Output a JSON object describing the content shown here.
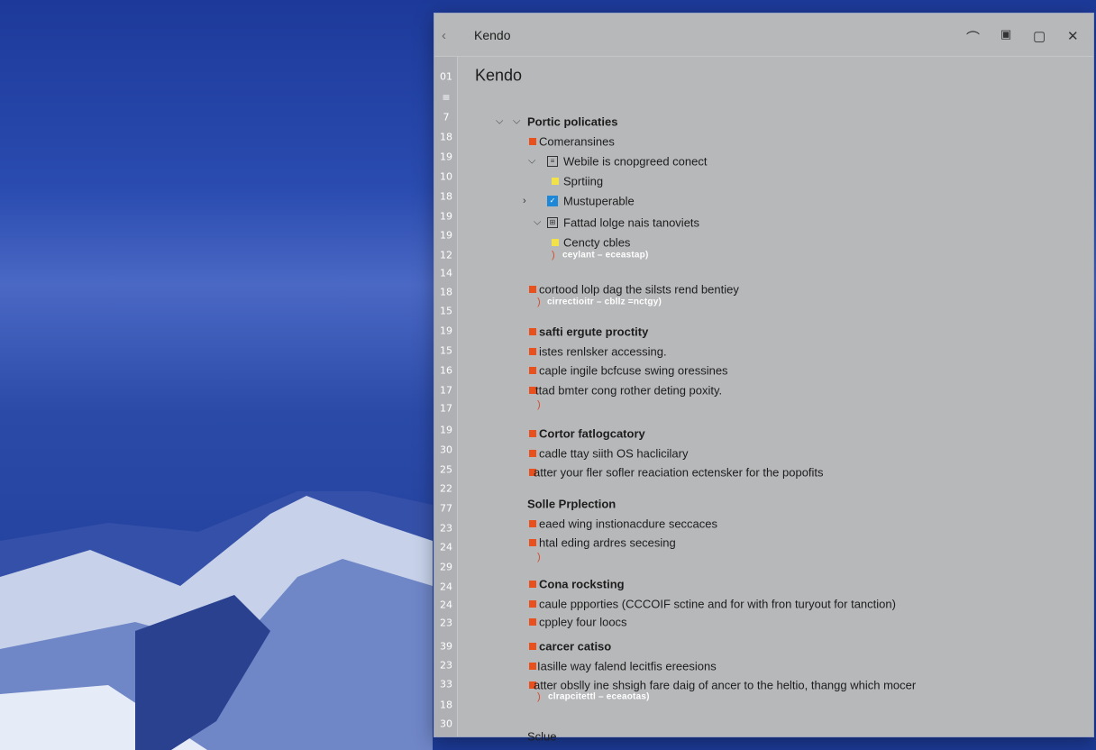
{
  "window": {
    "title": "Kendo",
    "heading": "Kendo"
  },
  "line_numbers": [
    "01",
    "≡",
    "7",
    "18",
    "19",
    "10",
    "18",
    "19",
    "19",
    "12",
    "14",
    "18",
    "15",
    "19",
    "15",
    "16",
    "17",
    "17",
    "19",
    "30",
    "25",
    "22",
    "77",
    "23",
    "24",
    "29",
    "24",
    "24",
    "23",
    "39",
    "23",
    "33",
    "18",
    "30"
  ],
  "tree": {
    "root": "Portic policaties",
    "item1": "Comeransines",
    "item2": "Webile is cnopgreed conect",
    "item3": "Sprtiing",
    "item4": "Mustuperable",
    "item5": "Fattad lolge nais tanoviets",
    "item6": "Cencty cbles",
    "comment1": "ceylant – eceastap)",
    "item7": "cortood lolp dag the silsts rend bentiey",
    "comment2": "cirrectioitr – cbllz =nctgy)"
  },
  "sections": [
    {
      "title": "safti ergute proctity",
      "items": [
        "istes renlsker accessing.",
        "caple ingile bcfcuse swing oressines",
        "ttad bmter cong rother deting poxity."
      ]
    },
    {
      "title": "Cortor fatlogcatory",
      "items": [
        "cadle ttay siith OS haclicilary",
        "atter your fler sofler reaciation ectensker for the popofits"
      ]
    },
    {
      "title": "Solle Prplection",
      "items": [
        "eaed wing instionacdure seccaces",
        "htal eding ardres secesing"
      ]
    },
    {
      "title": "Cona rocksting",
      "items": [
        "caule ppporties (CCCOIF sctine and for with fron turyout for tanction)",
        "cppley four loocs"
      ]
    },
    {
      "title": "carcer catiso",
      "items": [
        "Iasille way falend lecitfis ereesions",
        "atter obslly ine shsigh fare daig of ancer to the heltio, thangg which mocer"
      ],
      "comment": "clrapcitettl – eceaotas)"
    },
    {
      "title": "Sclue",
      "items": []
    }
  ],
  "paren": ")",
  "colors": {
    "marker": "#e8501e",
    "yellow": "#f2e24a",
    "window": "#b7b8ba"
  }
}
